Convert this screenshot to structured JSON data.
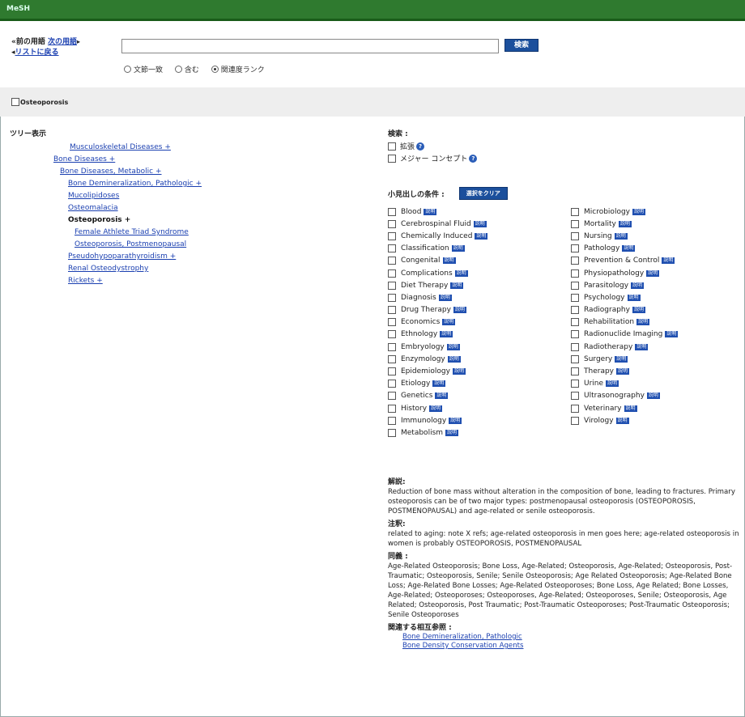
{
  "window": {
    "title": "MeSH"
  },
  "nav": {
    "prev": "前の用語",
    "next": "次の用語",
    "back": "リストに戻る",
    "arrow_left": "«",
    "arrow_right": "▸",
    "arrow_back": "◂"
  },
  "search": {
    "value": "",
    "button": "検索",
    "options": [
      "文節一致",
      "含む",
      "関連度ランク"
    ],
    "selected": 2
  },
  "term": {
    "label": "Osteoporosis"
  },
  "tree": {
    "header": "ツリー表示",
    "nodes": [
      {
        "label": "Musculoskeletal Diseases +",
        "level": 1,
        "link": true
      },
      {
        "label": "Bone Diseases +",
        "level": 2,
        "link": true
      },
      {
        "label": "Bone Diseases, Metabolic +",
        "level": 3,
        "link": true
      },
      {
        "label": "Bone Demineralization, Pathologic +",
        "level": 4,
        "link": true
      },
      {
        "label": "Mucolipidoses",
        "level": 4,
        "link": true
      },
      {
        "label": "Osteomalacia",
        "level": 4,
        "link": true
      },
      {
        "label": "Osteoporosis +",
        "level": 4,
        "link": false
      },
      {
        "label": "Female Athlete Triad Syndrome",
        "level": 5,
        "link": true
      },
      {
        "label": "Osteoporosis, Postmenopausal",
        "level": 5,
        "link": true
      },
      {
        "label": "Pseudohypoparathyroidism +",
        "level": 4,
        "link": true
      },
      {
        "label": "Renal Osteodystrophy",
        "level": 4,
        "link": true
      },
      {
        "label": "Rickets +",
        "level": 4,
        "link": true
      }
    ]
  },
  "search_opts": {
    "label": "検索 :",
    "items": [
      "拡張",
      "メジャー コンセプト"
    ]
  },
  "subheadings": {
    "label": "小見出しの条件 :",
    "select_button": "選択をクリア",
    "tag": "説明",
    "col1": [
      "Blood",
      "Cerebrospinal Fluid",
      "Chemically Induced",
      "Classification",
      "Congenital",
      "Complications",
      "Diet Therapy",
      "Diagnosis",
      "Drug Therapy",
      "Economics",
      "Ethnology",
      "Embryology",
      "Enzymology",
      "Epidemiology",
      "Etiology",
      "Genetics",
      "History",
      "Immunology",
      "Metabolism"
    ],
    "col2": [
      "Microbiology",
      "Mortality",
      "Nursing",
      "Pathology",
      "Prevention & Control",
      "Physiopathology",
      "Parasitology",
      "Psychology",
      "Radiography",
      "Rehabilitation",
      "Radionuclide Imaging",
      "Radiotherapy",
      "Surgery",
      "Therapy",
      "Urine",
      "Ultrasonography",
      "Veterinary",
      "Virology"
    ]
  },
  "definition": {
    "label": "解説:",
    "text": "Reduction of bone mass without alteration in the composition of bone, leading to fractures. Primary osteoporosis can be of two major types: postmenopausal osteoporosis (OSTEOPOROSIS, POSTMENOPAUSAL) and age-related or senile osteoporosis."
  },
  "note": {
    "label": "注釈:",
    "text": "related to aging: note X refs; age-related osteoporosis in men goes here; age-related osteoporosis in women is probably OSTEOPOROSIS, POSTMENOPAUSAL"
  },
  "entry_terms": {
    "label": "同義 :",
    "text": "Age-Related Osteoporosis; Bone Loss, Age-Related; Osteoporosis, Age-Related; Osteoporosis, Post-Traumatic; Osteoporosis, Senile; Senile Osteoporosis; Age Related Osteoporosis; Age-Related Bone Loss; Age-Related Bone Losses; Age-Related Osteoporoses; Bone Loss, Age Related; Bone Losses, Age-Related; Osteoporoses; Osteoporoses, Age-Related; Osteoporoses, Senile; Osteoporosis, Age Related; Osteoporosis, Post Traumatic; Post-Traumatic Osteoporoses; Post-Traumatic Osteoporosis; Senile Osteoporoses"
  },
  "see_also": {
    "label": "関連する相互参照 :",
    "items": [
      "Bone Demineralization, Pathologic",
      "Bone Density Conservation Agents"
    ]
  }
}
